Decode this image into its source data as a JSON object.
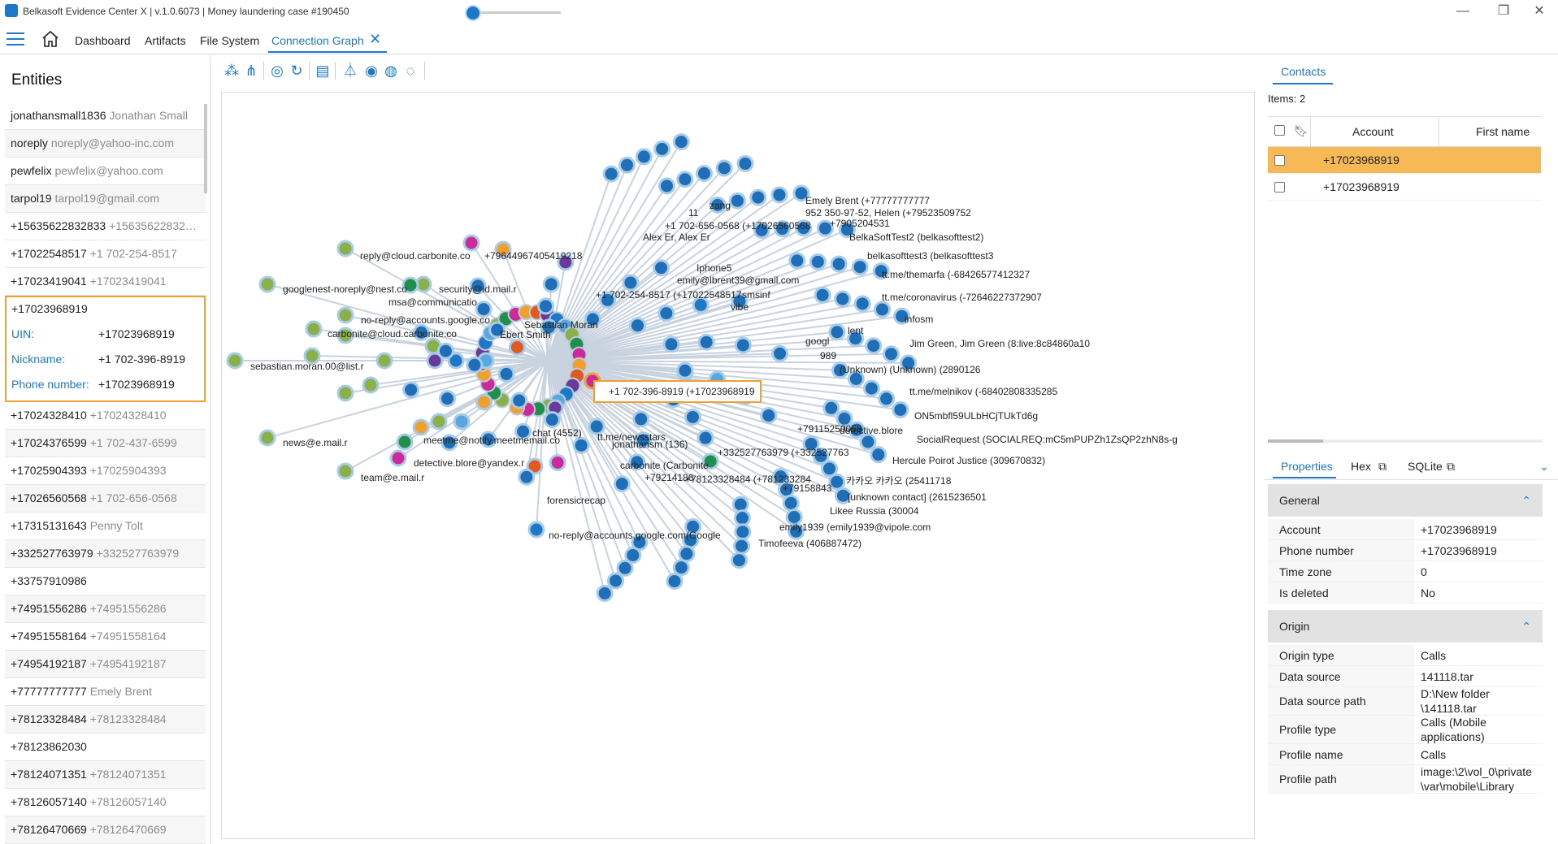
{
  "window": {
    "title": "Belkasoft Evidence Center X | v.1.0.6073 | Money laundering case #190450"
  },
  "menu": {
    "dashboard": "Dashboard",
    "artifacts": "Artifacts",
    "filesystem": "File System",
    "connection_graph": "Connection Graph"
  },
  "entities": {
    "title": "Entities",
    "items": [
      {
        "name": "jonathansmall1836",
        "sub": "Jonathan Small"
      },
      {
        "name": "noreply",
        "sub": "noreply@yahoo-inc.com"
      },
      {
        "name": "pewfelix",
        "sub": "pewfelix@yahoo.com"
      },
      {
        "name": "tarpol19",
        "sub": "tarpol19@gmail.com"
      },
      {
        "name": "+15635622832833",
        "sub": "+15635622832…"
      },
      {
        "name": "+17022548517",
        "sub": "+1 702-254-8517"
      },
      {
        "name": "+17023419041",
        "sub": "+17023419041"
      }
    ],
    "selected": {
      "number": "+17023968919",
      "uin_label": "UIN:",
      "uin": "+17023968919",
      "nick_label": "Nickname:",
      "nick": "+1 702-396-8919",
      "phone_label": "Phone number:",
      "phone": "+17023968919"
    },
    "items_after": [
      {
        "name": "+17024328410",
        "sub": "+17024328410"
      },
      {
        "name": "+17024376599",
        "sub": "+1 702-437-6599"
      },
      {
        "name": "+17025904393",
        "sub": "+17025904393"
      },
      {
        "name": "+17026560568",
        "sub": "+1 702-656-0568"
      },
      {
        "name": "+17315131643",
        "sub": "Penny Tolt"
      },
      {
        "name": "+332527763979",
        "sub": "+332527763979"
      },
      {
        "name": "+33757910986",
        "sub": ""
      },
      {
        "name": "+74951556286",
        "sub": "+74951556286"
      },
      {
        "name": "+74951558164",
        "sub": "+74951558164"
      },
      {
        "name": "+74954192187",
        "sub": "+74954192187"
      },
      {
        "name": "+77777777777",
        "sub": "Emely Brent"
      },
      {
        "name": "+78123328484",
        "sub": "+78123328484"
      },
      {
        "name": "+78123862030",
        "sub": ""
      },
      {
        "name": "+78124071351",
        "sub": "+78124071351"
      },
      {
        "name": "+78126057140",
        "sub": "+78126057140"
      },
      {
        "name": "+78126470669",
        "sub": "+78126470669"
      }
    ]
  },
  "graph": {
    "tooltip": "+1  702-396-8919 (+17023968919",
    "left_labels": [
      "reply@cloud.carbonite.co",
      "googlenest-noreply@nest.co",
      "security@id.mail.r",
      "msa@communicatio",
      "no-reply@accounts.google.co",
      "carbonite@cloud.carbonite.co",
      "sebastian.moran.00@list.r",
      "news@e.mail.r",
      "team@e.mail.r",
      "meetme@notify.meetmemail.co",
      "detective.blore@yandex.r",
      "+79644967405419218",
      "no-reply@accounts.google.com(Google"
    ],
    "right_labels": [
      "Emely Brent (+77777777777",
      "952 350-97-52, Helen (+79523509752",
      "+7905204531",
      "BelkaSoftTest2 (belkasofttest2)",
      "belkasofttest3 (belkasofttest3",
      "tt.me/themarfa (-68426577412327",
      "tt.me/coronavirus (-72646227372907",
      "infosm",
      "Jim Green, Jim Green (8:live:8c84860a10",
      "(Unknown) (Unknown) (2890126",
      "tt.me/melnikov (-68402808335285",
      "ON5mbfl59ULbHCjTUkTd6g",
      "SocialRequest (SOCIALREQ:mC5mPUPZh1ZsQP2zhN8s-g",
      "Hercule Poirot Justice (309670832)",
      "카카오 카카오 (25411718",
      "[unknown contact] (2615236501",
      "Likee Russia (30004",
      "emily1939 (emily1939@vipole.com",
      "Timofeeva (406887472)",
      "Alex Er, Alex Er",
      "+1 702-656-0568 (+17026560568",
      "zang",
      "11",
      "+1 702-254-8517 (+17022548517",
      "emily@lbrent39@gmail.com",
      "vibe",
      "smsinf",
      "lent",
      "googl",
      "989",
      "detective.blore",
      "+79115250058",
      "+79158843",
      "tt.me/newsstars",
      "+332527763979 (+332527763",
      "+78123328484 (+781233284",
      "carbonite (Carbonite",
      "Sebastian Moran",
      "Ebert Smith",
      "Iphone5",
      "jonathansm (136)",
      "chat (4552)",
      "forensicrecap",
      "+79214186"
    ]
  },
  "contacts": {
    "tab": "Contacts",
    "items_label": "Items: 2",
    "columns": [
      "Account",
      "First name"
    ],
    "rows": [
      {
        "account": "+17023968919",
        "first": ""
      },
      {
        "account": "+17023968919",
        "first": ""
      }
    ]
  },
  "properties": {
    "tabs": [
      "Properties",
      "Hex",
      "SQLite"
    ],
    "general_title": "General",
    "general": [
      {
        "k": "Account",
        "v": "+17023968919"
      },
      {
        "k": "Phone number",
        "v": "+17023968919"
      },
      {
        "k": "Time zone",
        "v": "0"
      },
      {
        "k": "Is deleted",
        "v": "No"
      }
    ],
    "origin_title": "Origin",
    "origin": [
      {
        "k": "Origin type",
        "v": "Calls"
      },
      {
        "k": "Data source",
        "v": "141118.tar"
      },
      {
        "k": "Data source path",
        "v": "D:\\New folder \\141118.tar"
      },
      {
        "k": "Profile type",
        "v": "Calls (Mobile applications)"
      },
      {
        "k": "Profile name",
        "v": "Calls"
      },
      {
        "k": "Profile path",
        "v": "image:\\2\\vol_0\\private \\var\\mobile\\Library"
      }
    ]
  },
  "colors": {
    "accent": "#1e78c8",
    "selection": "#f7b955",
    "entity_border": "#f0a030"
  }
}
